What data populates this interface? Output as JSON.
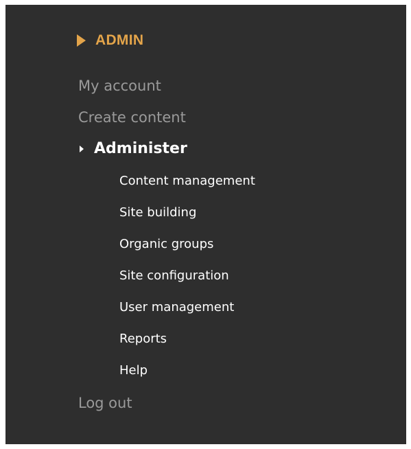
{
  "block": {
    "title": "ADMIN"
  },
  "menu": {
    "my_account": "My account",
    "create_content": "Create content",
    "administer": {
      "label": "Administer",
      "items": [
        "Content management",
        "Site building",
        "Organic groups",
        "Site configuration",
        "User management",
        "Reports",
        "Help"
      ]
    },
    "log_out": "Log out"
  },
  "colors": {
    "background": "#2e2e2e",
    "accent": "#e3a44a",
    "muted_link": "#9a9a9a",
    "active_link": "#ffffff"
  }
}
